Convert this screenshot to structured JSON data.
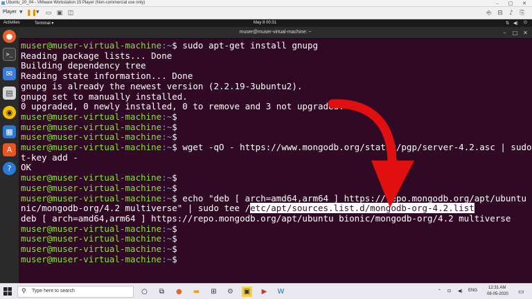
{
  "vmware": {
    "title": "Ubuntu_20_04 - VMware Workstation 15 Player (Non-commercial use only)",
    "player_label": "Player"
  },
  "ubuntu_panel": {
    "activities": "Activities",
    "app_menu": "Terminal ▾",
    "clock": "May 8  00:31"
  },
  "terminal": {
    "window_title": "muser@muser-virtual-machine: ~",
    "lines": [
      {
        "prompt": "muser@muser-virtual-machine",
        "path": ":~",
        "text": "$ sudo apt-get install gnupg"
      },
      {
        "text": "Reading package lists... Done"
      },
      {
        "text": "Building dependency tree"
      },
      {
        "text": "Reading state information... Done"
      },
      {
        "text": "gnupg is already the newest version (2.2.19-3ubuntu2)."
      },
      {
        "text": "gnupg set to manually installed."
      },
      {
        "text": "0 upgraded, 0 newly installed, 0 to remove and 3 not upgraded."
      },
      {
        "prompt": "muser@muser-virtual-machine",
        "path": ":~",
        "text": "$"
      },
      {
        "prompt": "muser@muser-virtual-machine",
        "path": ":~",
        "text": "$"
      },
      {
        "prompt": "muser@muser-virtual-machine",
        "path": ":~",
        "text": "$"
      },
      {
        "prompt": "muser@muser-virtual-machine",
        "path": ":~",
        "text": "$ wget -qO - https://www.mongodb.org/static/pgp/server-4.2.asc | sudo ap"
      },
      {
        "text": "t-key add -"
      },
      {
        "text": "OK"
      },
      {
        "prompt": "muser@muser-virtual-machine",
        "path": ":~",
        "text": "$"
      },
      {
        "prompt": "muser@muser-virtual-machine",
        "path": ":~",
        "text": "$"
      },
      {
        "prompt": "muser@muser-virtual-machine",
        "path": ":~",
        "text": "$ echo \"deb [ arch=amd64,arm64 ] https://repo.mongodb.org/apt/ubuntu bio"
      },
      {
        "text": "nic/mongodb-org/4.2 multiverse\" | sudo tee /",
        "highlight": "etc/apt/sources.list.d/mongodb-org-4.2.list"
      },
      {
        "text": "deb [ arch=amd64,arm64 ] https://repo.mongodb.org/apt/ubuntu bionic/mongodb-org/4.2 multiverse"
      },
      {
        "prompt": "muser@muser-virtual-machine",
        "path": ":~",
        "text": "$"
      },
      {
        "prompt": "muser@muser-virtual-machine",
        "path": ":~",
        "text": "$"
      },
      {
        "prompt": "muser@muser-virtual-machine",
        "path": ":~",
        "text": "$"
      },
      {
        "prompt": "muser@muser-virtual-machine",
        "path": ":~",
        "text": "$"
      }
    ]
  },
  "taskbar": {
    "search_placeholder": "Type here to search",
    "tray_lang": "ENG",
    "tray_time": "12:31 AM",
    "tray_date": "08-05-2020"
  },
  "colors": {
    "terminal_bg": "#300a24",
    "prompt_green": "#8ae234",
    "path_blue": "#729fcf",
    "arrow_red": "#e01010"
  }
}
